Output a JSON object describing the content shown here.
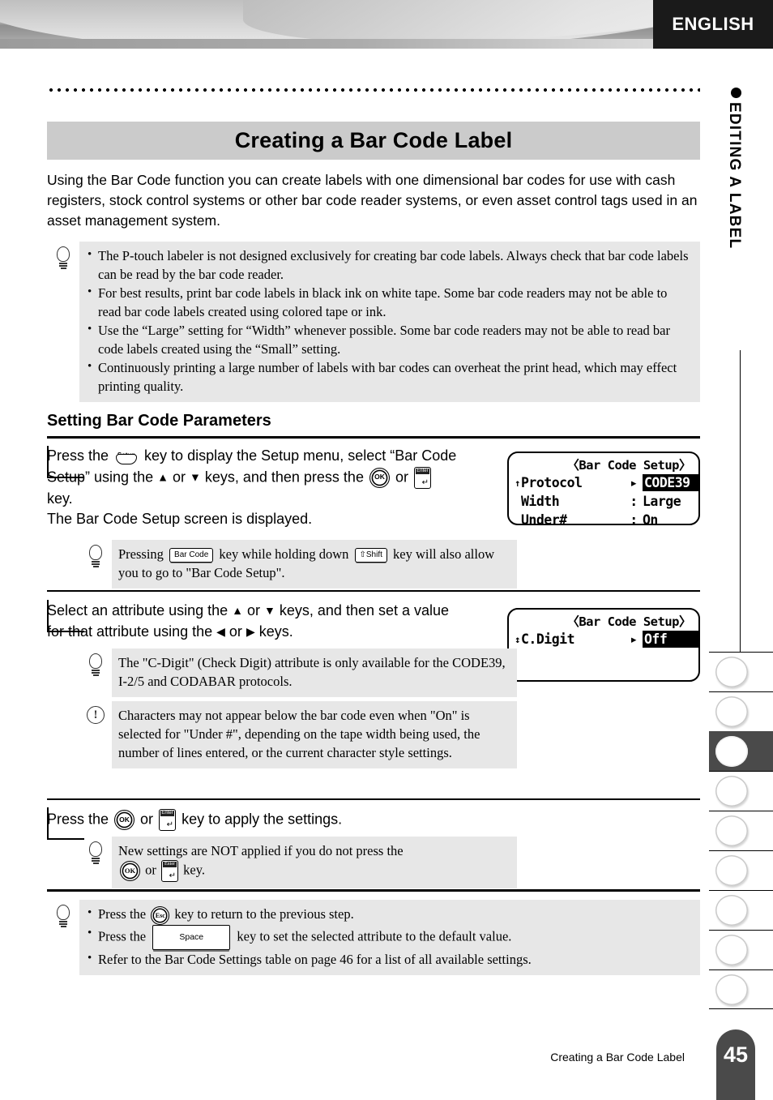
{
  "header": {
    "language_label": "ENGLISH"
  },
  "side_rail": {
    "chapter_label": "EDITING A LABEL",
    "bullet_icon": "filled-circle-icon",
    "tab_count": 9,
    "active_tab_index": 2
  },
  "title": "Creating a Bar Code Label",
  "intro": "Using the Bar Code function you can create labels with one dimensional bar codes for use with cash registers, stock control systems or other bar code reader systems, or even asset control tags used in an asset management system.",
  "top_note": {
    "icon": "lightbulb-icon",
    "bullets": [
      "The P-touch labeler is not designed exclusively for creating bar code labels. Always check that bar code labels can be read by the bar code reader.",
      "For best results, print bar code labels in black ink on white tape. Some bar code readers may not be able to read bar code labels created using colored tape or ink.",
      "Use the “Large” setting for “Width” whenever possible. Some bar code readers may not be able to read bar code labels created using the “Small” setting.",
      "Continuously printing a large number of labels with bar codes can overheat the print head, which may effect printing quality."
    ]
  },
  "section_heading": "Setting Bar Code Parameters",
  "steps": [
    {
      "text_parts": {
        "p1": "Press the ",
        "key1": "Setup",
        "p2": " key to display the Setup menu, select “Bar Code Setup” using the ",
        "up": "▲",
        "p3": " or ",
        "down": "▼",
        "p4": " keys, and then press the ",
        "key2": "OK",
        "p5": " or ",
        "key3": "Enter",
        "p6": " key.",
        "p7": "The Bar Code Setup screen is displayed."
      },
      "note": {
        "icon": "lightbulb-icon",
        "p1": "Pressing ",
        "key1": "Bar Code",
        "p2": " key while holding down ",
        "key2": "⇧Shift",
        "p3": " key will also allow you to go to  \"Bar Code Setup\"."
      },
      "lcd": {
        "title": "〈Bar Code Setup〉",
        "rows": [
          {
            "scroll": "↑",
            "label": "Protocol",
            "sep": "▸",
            "value": "CODE39",
            "highlight": true
          },
          {
            "scroll": "",
            "label": "Width",
            "sep": ":",
            "value": "Large",
            "highlight": false
          },
          {
            "scroll": "",
            "label": "Under#",
            "sep": ":",
            "value": "On",
            "highlight": false
          }
        ]
      }
    },
    {
      "text_parts": {
        "p1": "Select an attribute using the ",
        "up": "▲",
        "p2": " or ",
        "down": "▼",
        "p3": " keys, and then set a value for that attribute using the ",
        "left": "◀",
        "p4": " or ",
        "right": "▶",
        "p5": " keys."
      },
      "note_tip": {
        "icon": "lightbulb-icon",
        "text": "The \"C-Digit\" (Check Digit) attribute is only available for the CODE39, I-2/5 and CODABAR protocols."
      },
      "note_warn": {
        "icon": "exclamation-icon",
        "text": "Characters may not appear below the bar code even when \"On\" is selected for \"Under #\", depending on the tape width being used, the number of lines entered, or the current character style settings."
      },
      "lcd": {
        "title": "〈Bar Code Setup〉",
        "rows": [
          {
            "scroll": "↕",
            "label": "C.Digit",
            "sep": "▸",
            "value": "Off",
            "highlight": true
          }
        ]
      }
    },
    {
      "text_parts": {
        "p1": "Press the ",
        "key1": "OK",
        "p2": " or ",
        "key2": "Enter",
        "p3": " key to apply the settings."
      },
      "note": {
        "icon": "lightbulb-icon",
        "p1": "New settings are NOT applied if you do not press the ",
        "key1": "OK",
        "p2": " or ",
        "key2": "Enter",
        "p3": " key."
      }
    }
  ],
  "bottom_note": {
    "icon": "lightbulb-icon",
    "bullets": [
      {
        "p1": "Press the ",
        "key": "Esc",
        "key_type": "esc",
        "p2": " key to return to the previous step."
      },
      {
        "p1": "Press the ",
        "key": "Space",
        "key_type": "space",
        "p2": " key to set the selected attribute to the default value."
      },
      {
        "p1": "Refer to the Bar Code Settings table on page 46 for a list of all available settings.",
        "key": "",
        "key_type": "none",
        "p2": ""
      }
    ]
  },
  "footer": {
    "running_title": "Creating a Bar Code Label",
    "page_number": "45"
  }
}
